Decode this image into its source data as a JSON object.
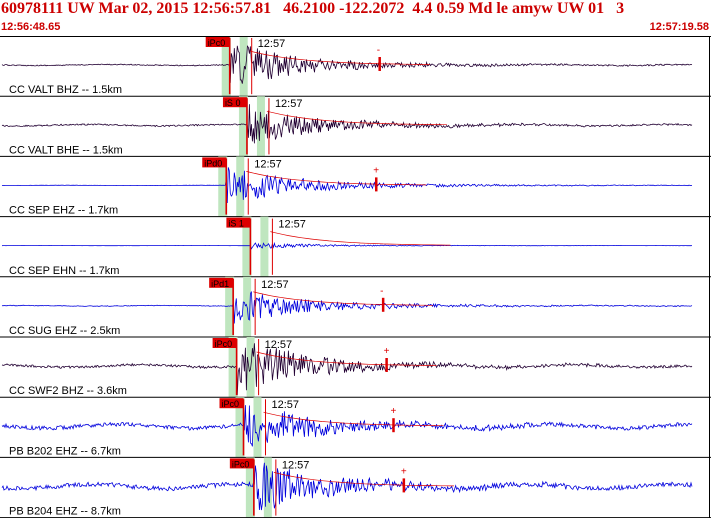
{
  "header": {
    "title": "60978111 UW Mar 02, 2015 12:56:57.81   46.2100 -122.2072  4.4 0.59 Md le amyw UW 01   3",
    "time_start": "12:56:48.65",
    "time_end": "12:57:19.58"
  },
  "colors": {
    "header_red": "#cc0000",
    "pick_red": "#dd0000",
    "trace_black": "#220033",
    "trace_blue": "#0000dd",
    "shade_green": "#bfe6bf",
    "grid": "#000000"
  },
  "channels": [
    {
      "label": "CC VALT BHZ -- 1.5km",
      "pick": "iPc0",
      "time_mark": "12:57",
      "color": "black",
      "amp": 0.8,
      "noise": 0.08,
      "onset": 0.33,
      "marker": "-"
    },
    {
      "label": "CC VALT BHE -- 1.5km",
      "pick": "iS 0",
      "time_mark": "12:57",
      "color": "black",
      "amp": 0.65,
      "noise": 0.12,
      "onset": 0.355,
      "marker": ""
    },
    {
      "label": "CC SEP EHZ -- 1.7km",
      "pick": "iPd0",
      "time_mark": "12:57",
      "color": "blue",
      "amp": 0.65,
      "noise": 0.02,
      "onset": 0.325,
      "marker": "+"
    },
    {
      "label": "CC SEP EHN -- 1.7km",
      "pick": "iS 1",
      "time_mark": "12:57",
      "color": "blue",
      "amp": 0.1,
      "noise": 0.01,
      "onset": 0.36,
      "marker": ""
    },
    {
      "label": "CC SUG EHZ -- 2.5km",
      "pick": "iPd1",
      "time_mark": "12:57",
      "color": "blue",
      "amp": 0.6,
      "noise": 0.05,
      "onset": 0.335,
      "marker": "-"
    },
    {
      "label": "CC SWF2 BHZ -- 3.6km",
      "pick": "iPc0",
      "time_mark": "12:57",
      "color": "black",
      "amp": 0.9,
      "noise": 0.2,
      "onset": 0.34,
      "marker": "+"
    },
    {
      "label": "PB B202 EHZ -- 6.7km",
      "pick": "iPc0",
      "time_mark": "12:57",
      "color": "blue",
      "amp": 0.75,
      "noise": 0.32,
      "onset": 0.35,
      "marker": "+"
    },
    {
      "label": "PB B204 EHZ -- 8.7km",
      "pick": "iPc0",
      "time_mark": "12:57",
      "color": "blue",
      "amp": 0.9,
      "noise": 0.36,
      "onset": 0.365,
      "marker": "+"
    }
  ]
}
